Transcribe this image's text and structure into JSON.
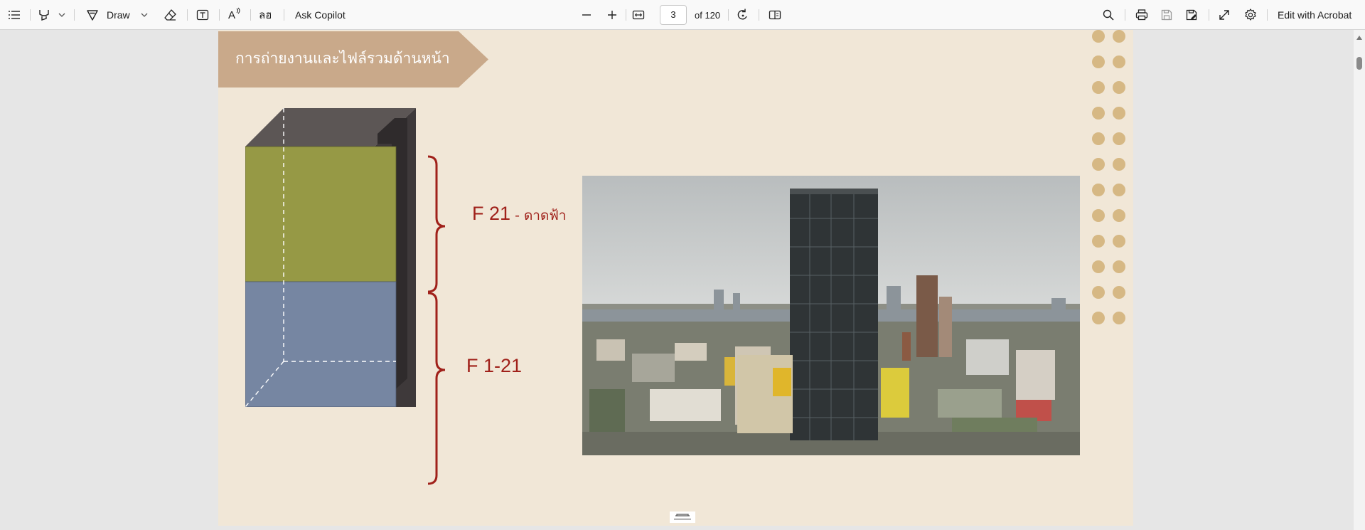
{
  "toolbar": {
    "draw_label": "Draw",
    "ask_copilot_label": "Ask Copilot",
    "current_page": "3",
    "page_total_label": "of 120",
    "edit_with_acrobat_label": "Edit with Acrobat",
    "icons": [
      "contents-icon",
      "highlight-icon",
      "highlight-dropdown-icon",
      "draw-icon",
      "draw-dropdown-icon",
      "eraser-icon",
      "text-box-icon",
      "read-aloud-icon",
      "translate-icon",
      "zoom-out-icon",
      "zoom-in-icon",
      "fit-to-width-icon",
      "rotate-icon",
      "page-view-icon",
      "search-icon",
      "print-icon",
      "save-icon",
      "save-as-icon",
      "fullscreen-icon",
      "settings-icon"
    ],
    "translate_glyph": "ลฮ",
    "read_aloud_glyph": "A"
  },
  "document": {
    "title": "การถ่ายงานและไฟล์รวมด้านหน้า",
    "label_top_main": "F 21",
    "label_top_sub": " - ดาดฟ้า",
    "label_bottom": "F 1-21",
    "colors": {
      "page_background": "#f1e7d7",
      "banner": "#c9a98a",
      "upper_block": "#969945",
      "lower_block": "#7686a2",
      "bracket": "#a0211a",
      "dots": "#d6b884"
    }
  }
}
